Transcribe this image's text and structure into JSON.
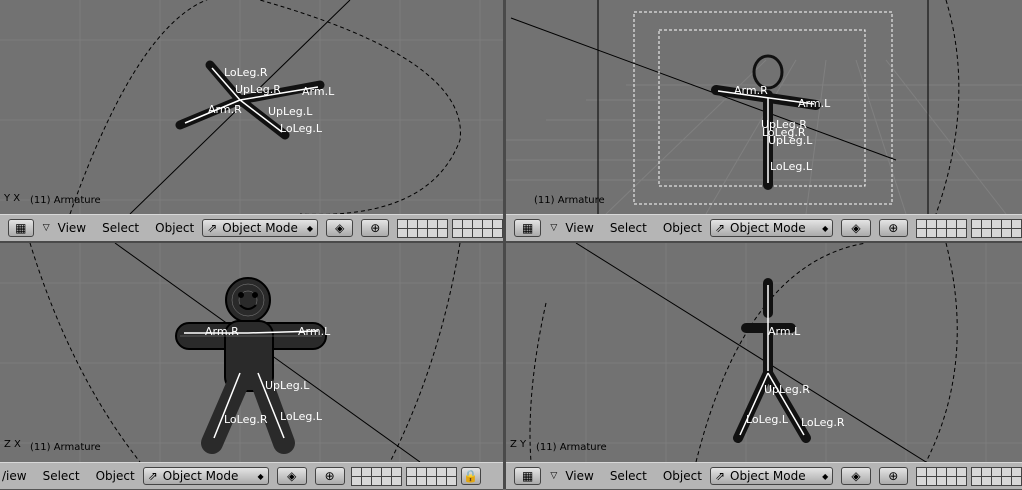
{
  "viewports": {
    "top_left": {
      "label": "(11) Armature",
      "axis": "Y X",
      "bones": [
        "LoLeg.R",
        "UpLeg.R",
        "Arm.R",
        "Arm.L",
        "UpLeg.L",
        "LoLeg.L"
      ]
    },
    "top_right": {
      "label": "(11) Armature",
      "bones": [
        "Arm.R",
        "Arm.L",
        "UpLeg.R",
        "LoLeg.R",
        "UpLeg.L",
        "LoLeg.L"
      ]
    },
    "bottom_left": {
      "label": "(11) Armature",
      "axis": "Z X",
      "bones": [
        "Arm.R",
        "Arm.L",
        "UpLeg.L",
        "LoLeg.R",
        "LoLeg.L"
      ]
    },
    "bottom_right": {
      "label": "(11) Armature",
      "axis": "Z Y",
      "bones": [
        "Arm.L",
        "UpLeg.R",
        "LoLeg.L",
        "LoLeg.R"
      ]
    }
  },
  "header": {
    "view": "View",
    "view_cut": "/iew",
    "select": "Select",
    "object": "Object",
    "mode": "Object Mode"
  },
  "icons": {
    "grid": "grid-menu-icon",
    "triangle": "collapse-triangle-icon",
    "mode": "object-mode-icon",
    "shading": "draw-type-icon",
    "pivot": "pivot-icon",
    "lock": "lock-icon"
  }
}
